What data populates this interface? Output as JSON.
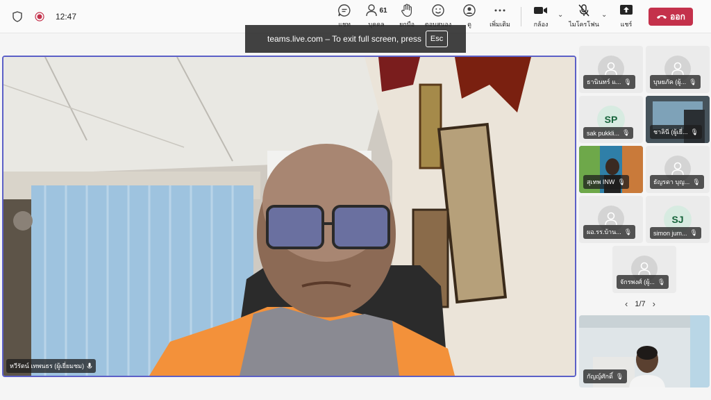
{
  "status": {
    "time": "12:47"
  },
  "toolbar": {
    "chat": "แชท",
    "people": "บุคคล",
    "people_count": "61",
    "raise": "ยกมือ",
    "react": "ตอบสนอง",
    "view": "ดู",
    "more": "เพิ่มเติม",
    "camera": "กล้อง",
    "mic": "ไมโครโฟน",
    "share": "แชร์",
    "leave": "ออก"
  },
  "toast": {
    "text": "teams.live.com – To exit full screen, press",
    "key": "Esc"
  },
  "main_speaker": {
    "name": "หวีรัตน์ เทพนธร (ผู้เยี่ยมชม)"
  },
  "participants": [
    {
      "name": "ธานินทร์ แ...",
      "type": "avatar"
    },
    {
      "name": "บุษยภัค (ผู้...",
      "type": "avatar"
    },
    {
      "name": "sak pukkli...",
      "type": "initials",
      "initials": "SP"
    },
    {
      "name": "ชาลินี (ผู้เยี่...",
      "type": "video"
    },
    {
      "name": "สุเทพ INW",
      "type": "video"
    },
    {
      "name": "ธัญรดา บุญ...",
      "type": "avatar"
    },
    {
      "name": "ผอ.รร.บ้าน...",
      "type": "avatar"
    },
    {
      "name": "simon jum...",
      "type": "initials",
      "initials": "SJ"
    },
    {
      "name": "จักรพงศ์ (ผู้...",
      "type": "avatar"
    }
  ],
  "pager": {
    "text": "1/7"
  },
  "self_view": {
    "name": "กัญญ์ศักดิ์"
  },
  "colors": {
    "accent": "#5b5fc7",
    "leave": "#c4314b"
  }
}
